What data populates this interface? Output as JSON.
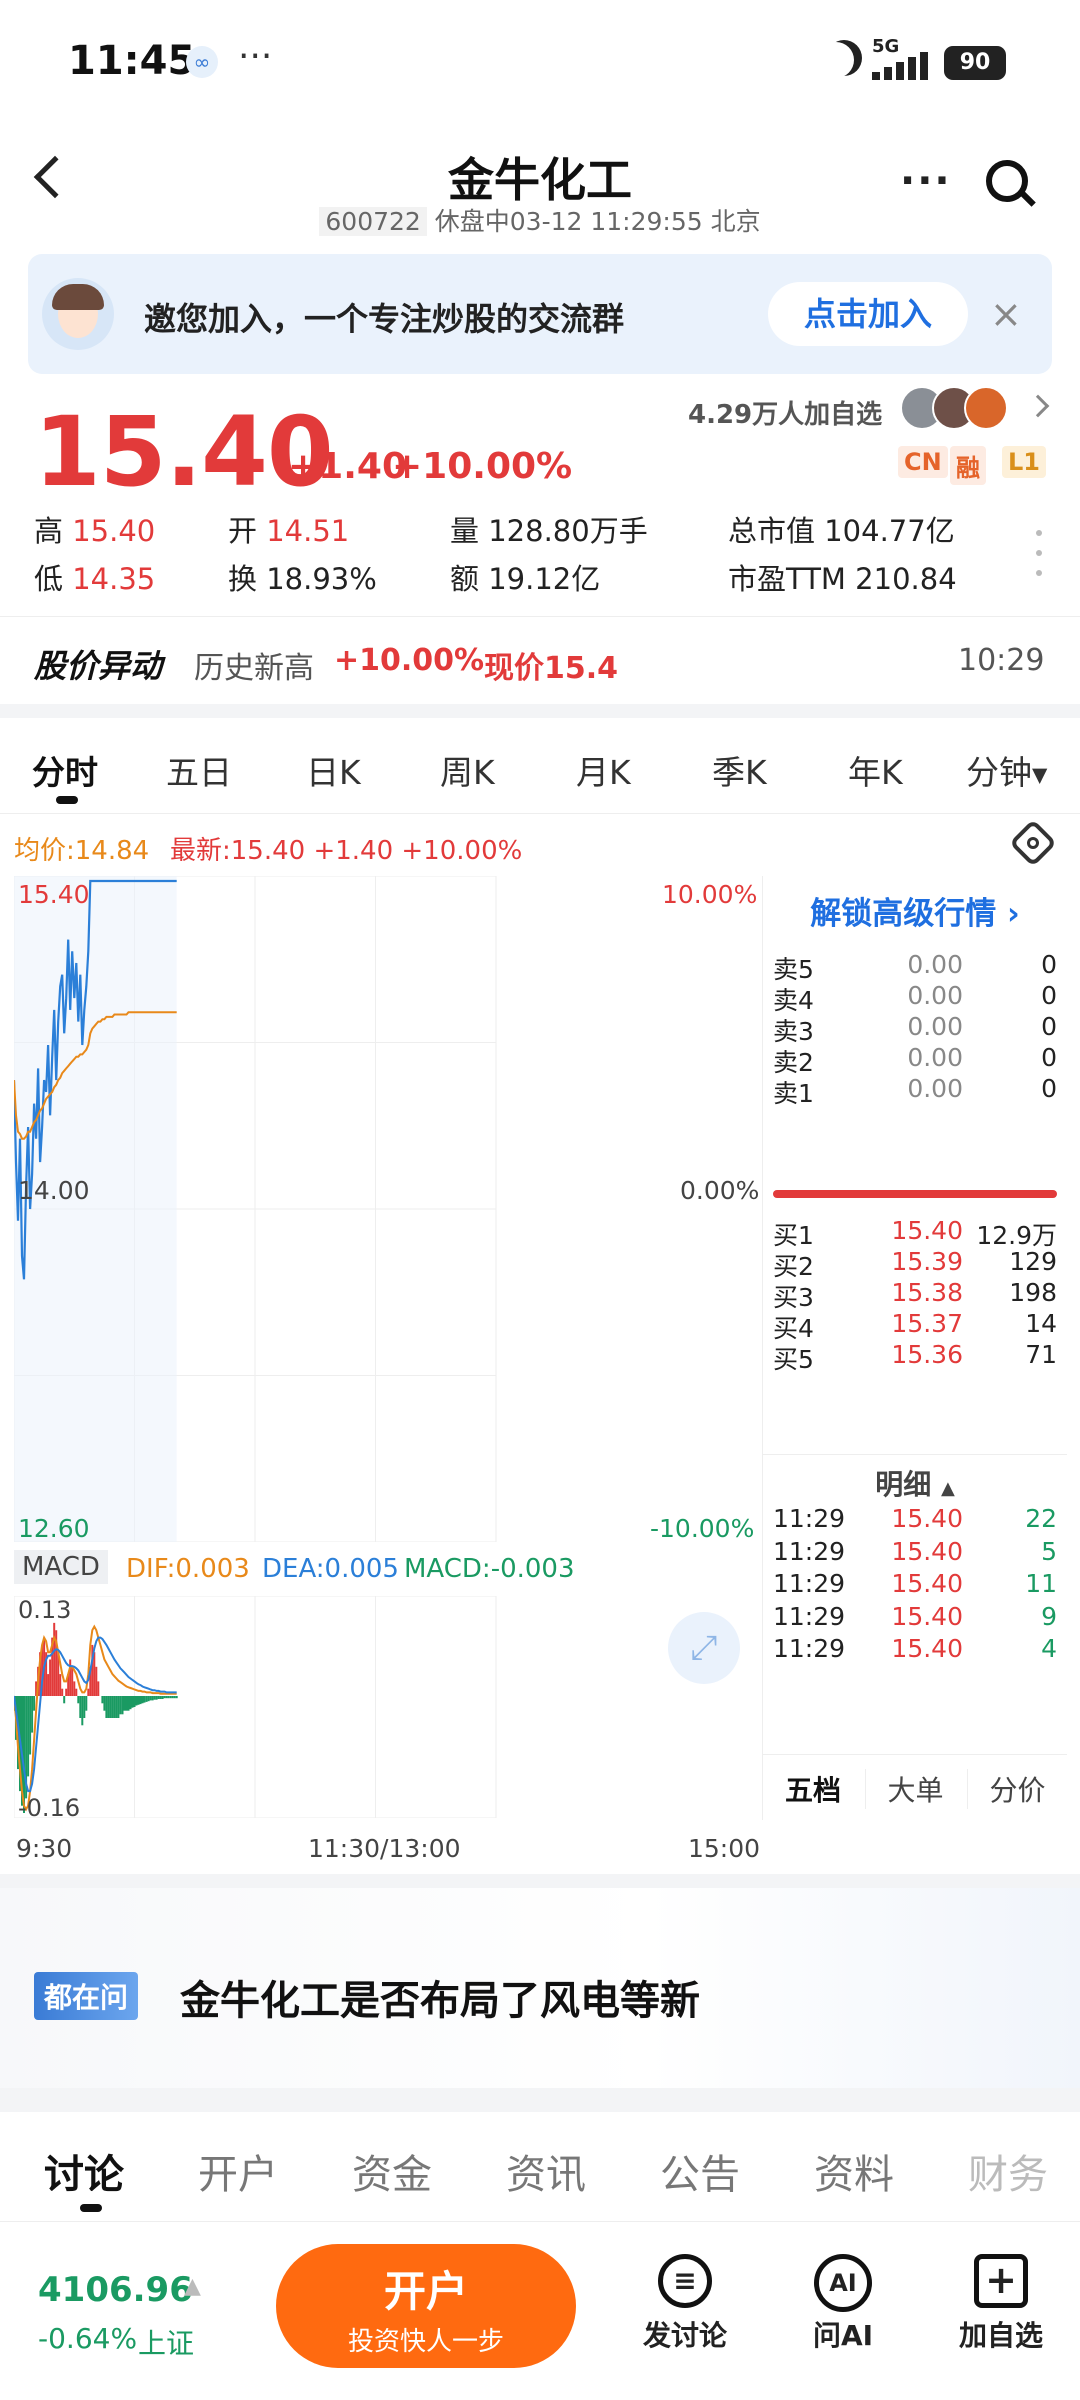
{
  "status_bar": {
    "time": "11:45",
    "dots": "···",
    "network": "5G",
    "battery": "90"
  },
  "header": {
    "title": "金牛化工",
    "code": "600722",
    "status": "休盘中03-12 11:29:55 北京"
  },
  "banner": {
    "text": "邀您加入，一个专注炒股的交流群",
    "join": "点击加入"
  },
  "quote": {
    "price": "15.40",
    "change": "+1.40",
    "change_pct": "+10.00%",
    "followers": "4.29万人加自选",
    "tags": [
      "CN",
      "融",
      "L1"
    ],
    "stats": [
      {
        "label": "高",
        "value": "15.40",
        "color": "red"
      },
      {
        "label": "开",
        "value": "14.51",
        "color": "red"
      },
      {
        "label": "量",
        "value": "128.80万手",
        "color": "dark"
      },
      {
        "label": "总市值",
        "value": "104.77亿",
        "color": "dark"
      },
      {
        "label": "低",
        "value": "14.35",
        "color": "red"
      },
      {
        "label": "换",
        "value": "18.93%",
        "color": "dark"
      },
      {
        "label": "额",
        "value": "19.12亿",
        "color": "dark"
      },
      {
        "label": "市盈TTM",
        "value": "210.84",
        "color": "dark"
      }
    ]
  },
  "alert": {
    "title": "股价异动",
    "event": "历史新高",
    "pct": "+10.00%",
    "now": "现价15.4",
    "time": "10:29"
  },
  "chart_tabs": [
    "分时",
    "五日",
    "日K",
    "周K",
    "月K",
    "季K",
    "年K",
    "分钟"
  ],
  "chart_header": {
    "avg": "均价:14.84",
    "latest": "最新:15.40 +1.40 +10.00%"
  },
  "chart_data": {
    "type": "line",
    "title": "",
    "y_axis_left": [
      "15.40",
      "14.00",
      "12.60"
    ],
    "y_axis_right": [
      "10.00%",
      "0.00%",
      "-10.00%"
    ],
    "ylim": [
      12.6,
      15.4
    ],
    "x_ticks": [
      "9:30",
      "11:30/13:00",
      "15:00"
    ],
    "total_minutes": 240,
    "series": [
      {
        "values": [
          14.55,
          14.2,
          13.95,
          14.3,
          13.8,
          13.7,
          14.1,
          14.35,
          14.0,
          14.15,
          14.45,
          14.3,
          14.6,
          14.2,
          14.35,
          14.55,
          14.5,
          14.7,
          14.4,
          14.65,
          14.85,
          14.55,
          14.8,
          14.95,
          15.0,
          14.75,
          14.9,
          15.15,
          14.85,
          15.1,
          14.9,
          15.05,
          14.8,
          15.0,
          14.7,
          14.85,
          14.95,
          15.1,
          15.4,
          15.4,
          15.4,
          15.4,
          15.4,
          15.4,
          15.4,
          15.4,
          15.4,
          15.4,
          15.4,
          15.4,
          15.4,
          15.4,
          15.4,
          15.4,
          15.4,
          15.4,
          15.4,
          15.4,
          15.4,
          15.4,
          15.4,
          15.4,
          15.4,
          15.4,
          15.4,
          15.4,
          15.4,
          15.4,
          15.4,
          15.4,
          15.4,
          15.4,
          15.4,
          15.4,
          15.4,
          15.4,
          15.4,
          15.4,
          15.4,
          15.4,
          15.4,
          15.4
        ],
        "color": "#2b7fd8"
      },
      {
        "values": [
          14.55,
          14.4,
          14.33,
          14.32,
          14.3,
          14.3,
          14.31,
          14.33,
          14.33,
          14.35,
          14.37,
          14.38,
          14.4,
          14.42,
          14.43,
          14.45,
          14.47,
          14.48,
          14.49,
          14.5,
          14.52,
          14.53,
          14.55,
          14.56,
          14.58,
          14.59,
          14.6,
          14.61,
          14.62,
          14.63,
          14.64,
          14.65,
          14.65,
          14.66,
          14.66,
          14.67,
          14.68,
          14.7,
          14.75,
          14.77,
          14.78,
          14.79,
          14.8,
          14.8,
          14.81,
          14.81,
          14.82,
          14.82,
          14.82,
          14.82,
          14.83,
          14.83,
          14.83,
          14.83,
          14.83,
          14.83,
          14.83,
          14.84,
          14.84,
          14.84,
          14.84,
          14.84,
          14.84,
          14.84,
          14.84,
          14.84,
          14.84,
          14.84,
          14.84,
          14.84,
          14.84,
          14.84,
          14.84,
          14.84,
          14.84,
          14.84,
          14.84,
          14.84,
          14.84,
          14.84,
          14.84,
          14.84
        ],
        "color": "#e8891a"
      }
    ]
  },
  "macd": {
    "label": "MACD",
    "dif": "DIF:0.003",
    "dea": "DEA:0.005",
    "macd": "MACD:-0.003",
    "top": "0.13",
    "bottom": "-0.16",
    "ylim": [
      -0.16,
      0.13
    ],
    "bars": [
      -0.02,
      -0.06,
      -0.1,
      -0.13,
      -0.15,
      -0.16,
      -0.14,
      -0.11,
      -0.08,
      -0.05,
      -0.02,
      0.02,
      0.04,
      0.06,
      0.07,
      0.08,
      0.06,
      0.03,
      0.05,
      0.08,
      0.1,
      0.09,
      0.06,
      0.03,
      0.01,
      -0.01,
      0.01,
      0.03,
      0.05,
      0.04,
      0.02,
      0.01,
      -0.01,
      -0.03,
      -0.04,
      -0.03,
      -0.02,
      0.01,
      0.04,
      0.07,
      0.06,
      0.04,
      0.02,
      0.0,
      -0.01,
      -0.02,
      -0.03,
      -0.03,
      -0.03,
      -0.03,
      -0.03,
      -0.03,
      -0.03,
      -0.025,
      -0.025,
      -0.02,
      -0.02,
      -0.02,
      -0.018,
      -0.016,
      -0.015,
      -0.013,
      -0.012,
      -0.011,
      -0.01,
      -0.009,
      -0.008,
      -0.007,
      -0.006,
      -0.006,
      -0.005,
      -0.005,
      -0.004,
      -0.004,
      -0.004,
      -0.003,
      -0.003,
      -0.003,
      -0.003,
      -0.003,
      -0.003,
      -0.003
    ],
    "dif_line": [
      0.0,
      -0.03,
      -0.07,
      -0.1,
      -0.13,
      -0.15,
      -0.155,
      -0.15,
      -0.13,
      -0.1,
      -0.06,
      -0.02,
      0.02,
      0.05,
      0.07,
      0.08,
      0.075,
      0.06,
      0.06,
      0.07,
      0.08,
      0.075,
      0.06,
      0.045,
      0.03,
      0.02,
      0.02,
      0.03,
      0.04,
      0.04,
      0.035,
      0.03,
      0.02,
      0.01,
      0.005,
      0.005,
      0.01,
      0.03,
      0.07,
      0.09,
      0.095,
      0.09,
      0.08,
      0.07,
      0.06,
      0.05,
      0.045,
      0.04,
      0.035,
      0.03,
      0.027,
      0.024,
      0.021,
      0.019,
      0.017,
      0.015,
      0.013,
      0.012,
      0.011,
      0.01,
      0.009,
      0.008,
      0.007,
      0.007,
      0.006,
      0.006,
      0.005,
      0.005,
      0.005,
      0.004,
      0.004,
      0.004,
      0.004,
      0.003,
      0.003,
      0.003,
      0.003,
      0.003,
      0.003,
      0.003,
      0.003,
      0.003
    ],
    "dea_line": [
      0.0,
      -0.02,
      -0.04,
      -0.06,
      -0.08,
      -0.1,
      -0.12,
      -0.13,
      -0.13,
      -0.12,
      -0.1,
      -0.07,
      -0.04,
      -0.01,
      0.02,
      0.04,
      0.05,
      0.055,
      0.055,
      0.058,
      0.062,
      0.064,
      0.063,
      0.06,
      0.055,
      0.05,
      0.045,
      0.042,
      0.041,
      0.041,
      0.04,
      0.038,
      0.035,
      0.03,
      0.025,
      0.02,
      0.018,
      0.022,
      0.035,
      0.05,
      0.065,
      0.075,
      0.08,
      0.08,
      0.078,
      0.074,
      0.07,
      0.065,
      0.06,
      0.055,
      0.05,
      0.046,
      0.042,
      0.038,
      0.035,
      0.032,
      0.029,
      0.026,
      0.024,
      0.022,
      0.02,
      0.018,
      0.016,
      0.015,
      0.013,
      0.012,
      0.011,
      0.01,
      0.009,
      0.008,
      0.008,
      0.007,
      0.007,
      0.006,
      0.006,
      0.006,
      0.005,
      0.005,
      0.005,
      0.005,
      0.005,
      0.005
    ]
  },
  "orderbook": {
    "unlock": "解锁高级行情",
    "sell": [
      {
        "label": "卖5",
        "price": "0.00",
        "vol": "0"
      },
      {
        "label": "卖4",
        "price": "0.00",
        "vol": "0"
      },
      {
        "label": "卖3",
        "price": "0.00",
        "vol": "0"
      },
      {
        "label": "卖2",
        "price": "0.00",
        "vol": "0"
      },
      {
        "label": "卖1",
        "price": "0.00",
        "vol": "0"
      }
    ],
    "buy": [
      {
        "label": "买1",
        "price": "15.40",
        "vol": "12.9万"
      },
      {
        "label": "买2",
        "price": "15.39",
        "vol": "129"
      },
      {
        "label": "买3",
        "price": "15.38",
        "vol": "198"
      },
      {
        "label": "买4",
        "price": "15.37",
        "vol": "14"
      },
      {
        "label": "买5",
        "price": "15.36",
        "vol": "71"
      }
    ],
    "detail_title": "明细",
    "details": [
      {
        "time": "11:29",
        "price": "15.40",
        "vol": "22"
      },
      {
        "time": "11:29",
        "price": "15.40",
        "vol": "5"
      },
      {
        "time": "11:29",
        "price": "15.40",
        "vol": "11"
      },
      {
        "time": "11:29",
        "price": "15.40",
        "vol": "9"
      },
      {
        "time": "11:29",
        "price": "15.40",
        "vol": "4"
      }
    ],
    "tabs": [
      "五档",
      "大单",
      "分价"
    ]
  },
  "qa": {
    "badge": "都在问",
    "text": "金牛化工是否布局了风电等新"
  },
  "bottom_tabs": [
    "讨论",
    "开户",
    "资金",
    "资讯",
    "公告",
    "资料",
    "财务"
  ],
  "footer": {
    "index_value": "4106.96",
    "index_change": "-0.64%",
    "index_name": "上证",
    "open_title": "开户",
    "open_sub": "投资快人一步",
    "actions": [
      "发讨论",
      "问AI",
      "加自选"
    ]
  }
}
